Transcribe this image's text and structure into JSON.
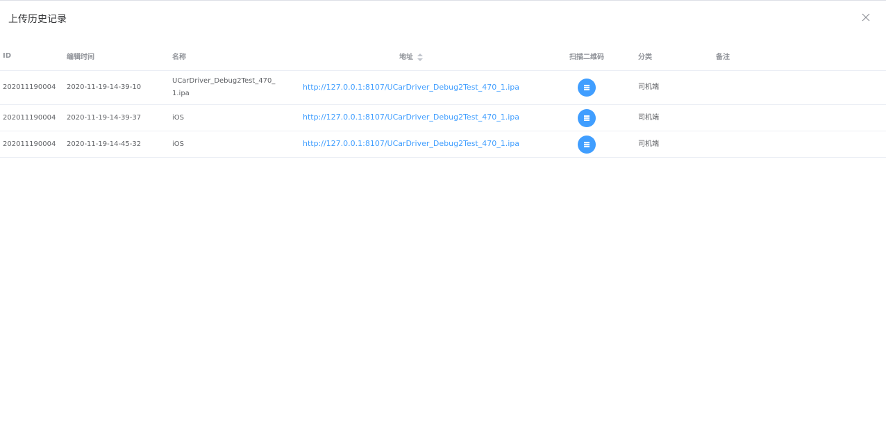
{
  "dialog": {
    "title": "上传历史记录",
    "close_icon": "close-icon"
  },
  "table": {
    "columns": {
      "id": "ID",
      "edit_time": "编辑时间",
      "name": "名称",
      "url": "地址",
      "qr": "扫描二维码",
      "category": "分类",
      "remark": "备注"
    },
    "rows": [
      {
        "id": "202011190004",
        "edit_time": "2020-11-19-14-39-10",
        "name": "UCarDriver_Debug2Test_470_1.ipa",
        "url": "http://127.0.0.1:8107/UCarDriver_Debug2Test_470_1.ipa",
        "category": "司机端",
        "remark": ""
      },
      {
        "id": "202011190004",
        "edit_time": "2020-11-19-14-39-37",
        "name": "iOS",
        "url": "http://127.0.0.1:8107/UCarDriver_Debug2Test_470_1.ipa",
        "category": "司机端",
        "remark": ""
      },
      {
        "id": "202011190004",
        "edit_time": "2020-11-19-14-45-32",
        "name": "iOS",
        "url": "http://127.0.0.1:8107/UCarDriver_Debug2Test_470_1.ipa",
        "category": "司机端",
        "remark": ""
      }
    ]
  },
  "colors": {
    "accent": "#409eff",
    "text": "#606266",
    "header_text": "#909399",
    "border": "#ebeef5"
  }
}
